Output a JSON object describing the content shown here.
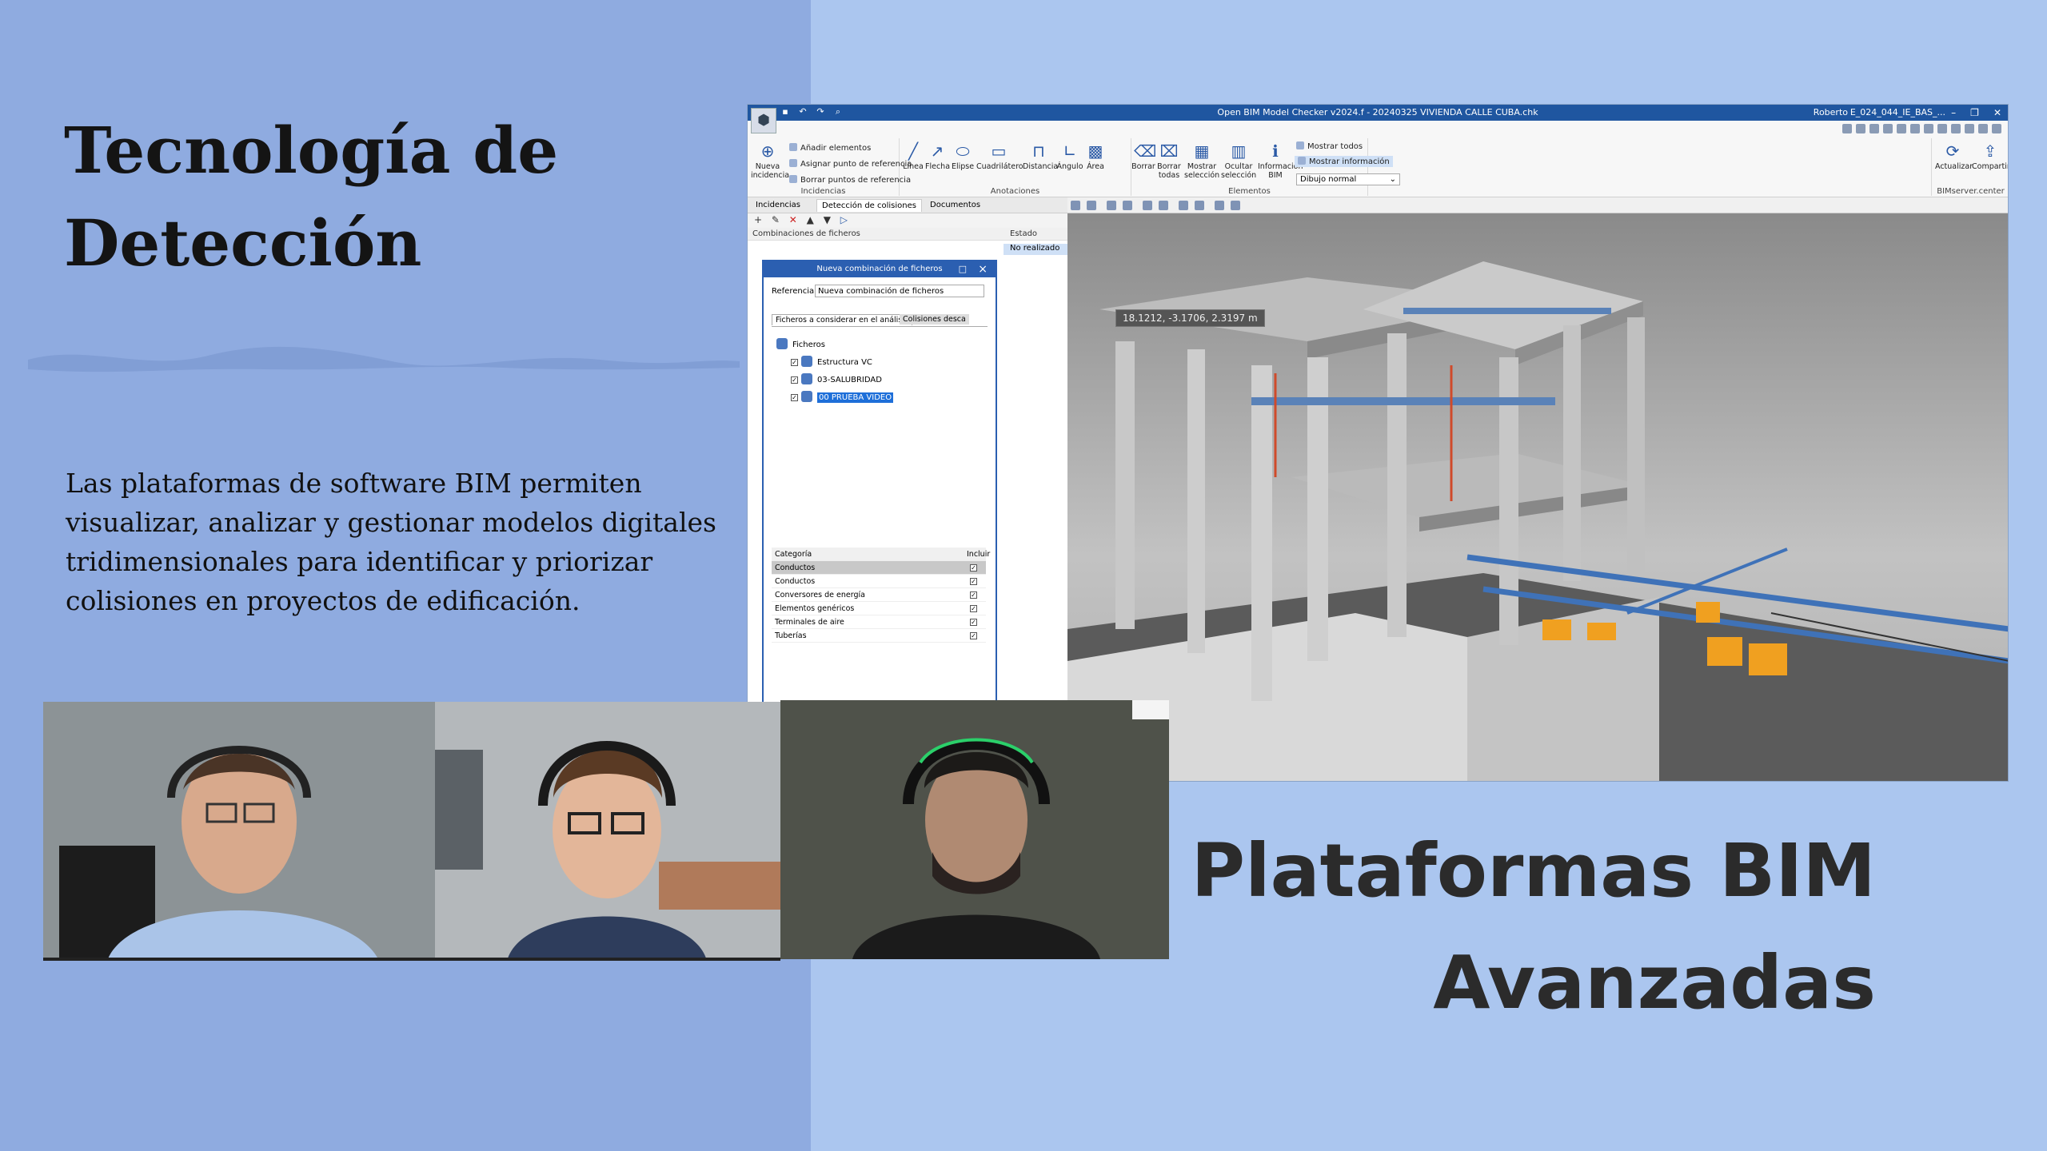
{
  "slide": {
    "headline_line1": "Tecnología de",
    "headline_line2": "Detección",
    "description": "Las plataformas de software BIM permiten visualizar, analizar y gestionar modelos digitales tridimensionales para identificar y priorizar colisiones en proyectos de edificación.",
    "bottom_title_line1": "Plataformas BIM",
    "bottom_title_line2": "Avanzadas"
  },
  "app": {
    "window_title": "Open BIM Model Checker v2024.f - 20240325 VIVIENDA CALLE CUBA.chk",
    "user": "Roberto",
    "file_badge": "E_024_044_IE_BAS_..."
  },
  "ribbon": {
    "incidencias": {
      "nueva_label": "Nueva incidencia",
      "anadir": "Añadir elementos",
      "asignar": "Asignar punto de referencia",
      "borrar": "Borrar puntos de referencia",
      "group": "Incidencias"
    },
    "anotaciones": {
      "buttons": [
        "Línea",
        "Flecha",
        "Elipse",
        "Cuadrilátero",
        "Distancia",
        "Ángulo",
        "Área",
        "Borrar",
        "Borrar todas"
      ],
      "group": "Anotaciones"
    },
    "elementos": {
      "mostrar_sel": "Mostrar selección",
      "ocultar_sel": "Ocultar selección",
      "info_bim": "Información BIM",
      "mostrar_todos": "Mostrar todos",
      "mostrar_info": "Mostrar información",
      "dibujo": "Dibujo normal",
      "group": "Elementos"
    },
    "bimserver": {
      "actualizar": "Actualizar",
      "compartir": "Compartir",
      "group": "BIMserver.center"
    }
  },
  "left_panel": {
    "tabs": [
      "Incidencias",
      "Detección de colisiones",
      "Documentos"
    ],
    "col_combinaciones": "Combinaciones de ficheros",
    "col_estado": "Estado",
    "status": "No realizado"
  },
  "dialog": {
    "title": "Nueva combinación de ficheros",
    "ref_label": "Referencia",
    "ref_value": "Nueva combinación de ficheros",
    "tab1": "Ficheros a considerar en el análisis",
    "tab2": "Colisiones desca",
    "tree_root": "Ficheros",
    "tree_items": [
      "Estructura VC",
      "03-SALUBRIDAD",
      "00 PRUEBA VIDEO"
    ],
    "cat_header": "Categoría",
    "inc_header": "Incluir",
    "categories": [
      "Conductos",
      "Conductos",
      "Conversores de energía",
      "Elementos genéricos",
      "Terminales de aire",
      "Tuberías"
    ]
  },
  "viewport": {
    "coordinates": "18.1212, -3.1706, 2.3197 m"
  },
  "colors": {
    "left_bg": "#8fabe0",
    "right_bg": "#abc6ef",
    "titlebar": "#1f56a0",
    "dialog_accent": "#2b5fb1"
  }
}
